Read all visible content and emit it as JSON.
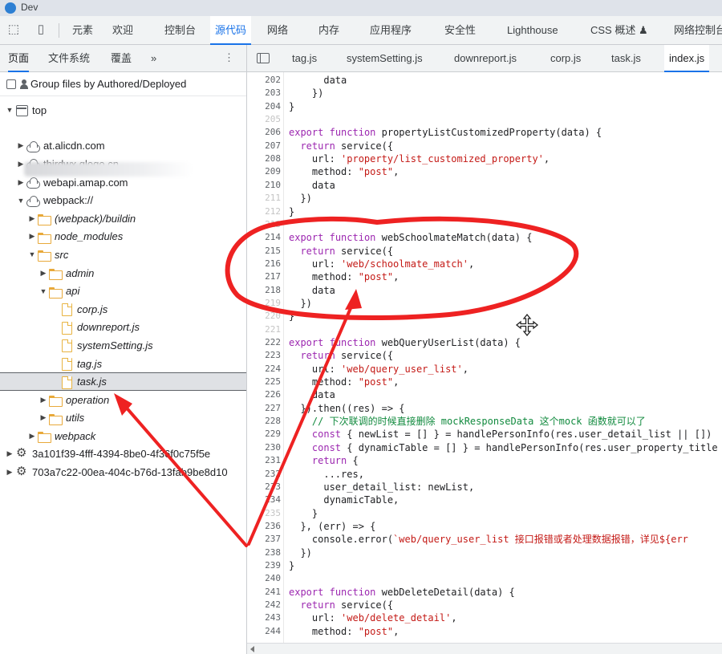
{
  "window": {
    "title": "Dev"
  },
  "toolbar": {
    "tabs": [
      "元素",
      "欢迎",
      "控制台",
      "源代码",
      "网络",
      "内存",
      "应用程序",
      "安全性",
      "Lighthouse",
      "CSS 概述 ♟",
      "网络控制台"
    ],
    "active_index": 3
  },
  "sidebar": {
    "tabs": [
      "页面",
      "文件系统",
      "覆盖",
      "»"
    ],
    "more": "⋮",
    "group_label": "Group files by Authored/Deployed",
    "tree": [
      {
        "label": "top",
        "depth": 0,
        "arrow": "▼",
        "icon": "frame-icon"
      },
      {
        "label": "at.alicdn.com",
        "depth": 1,
        "arrow": "▶",
        "icon": "cloud-icon"
      },
      {
        "label": "thirdwx.qlogo.cn",
        "depth": 1,
        "arrow": "▶",
        "icon": "cloud-icon"
      },
      {
        "label": "webapi.amap.com",
        "depth": 1,
        "arrow": "▶",
        "icon": "cloud-icon"
      },
      {
        "label": "webpack://",
        "depth": 1,
        "arrow": "▼",
        "icon": "cloud-icon"
      },
      {
        "label": "(webpack)/buildin",
        "depth": 2,
        "arrow": "▶",
        "icon": "folder-icon",
        "italic": true
      },
      {
        "label": "node_modules",
        "depth": 2,
        "arrow": "▶",
        "icon": "folder-icon",
        "italic": true
      },
      {
        "label": "src",
        "depth": 2,
        "arrow": "▼",
        "icon": "folder-icon",
        "italic": true
      },
      {
        "label": "admin",
        "depth": 3,
        "arrow": "▶",
        "icon": "folder-icon",
        "italic": true
      },
      {
        "label": "api",
        "depth": 3,
        "arrow": "▼",
        "icon": "folder-icon",
        "italic": true
      },
      {
        "label": "corp.js",
        "depth": 4,
        "arrow": "",
        "icon": "file-icon",
        "italic": true
      },
      {
        "label": "downreport.js",
        "depth": 4,
        "arrow": "",
        "icon": "file-icon",
        "italic": true
      },
      {
        "label": "systemSetting.js",
        "depth": 4,
        "arrow": "",
        "icon": "file-icon",
        "italic": true
      },
      {
        "label": "tag.js",
        "depth": 4,
        "arrow": "",
        "icon": "file-icon",
        "italic": true
      },
      {
        "label": "task.js",
        "depth": 4,
        "arrow": "",
        "icon": "file-icon",
        "italic": true,
        "selected": true
      },
      {
        "label": "operation",
        "depth": 3,
        "arrow": "▶",
        "icon": "folder-icon",
        "italic": true
      },
      {
        "label": "utils",
        "depth": 3,
        "arrow": "▶",
        "icon": "folder-icon",
        "italic": true
      },
      {
        "label": "webpack",
        "depth": 2,
        "arrow": "▶",
        "icon": "folder-icon",
        "italic": true
      },
      {
        "label": "3a101f39-4fff-4394-8be0-4f36f0c75f5e",
        "depth": 0,
        "arrow": "▶",
        "icon": "gear-icon"
      },
      {
        "label": "703a7c22-00ea-404c-b76d-13fab9be8d10",
        "depth": 0,
        "arrow": "▶",
        "icon": "gear-icon"
      }
    ]
  },
  "editor": {
    "tabs": [
      "tag.js",
      "systemSetting.js",
      "downreport.js",
      "corp.js",
      "task.js",
      "index.js"
    ],
    "active_index": 5,
    "lines": [
      {
        "n": "202",
        "t": "      data"
      },
      {
        "n": "203",
        "t": "    })"
      },
      {
        "n": "204",
        "t": "}"
      },
      {
        "n": "205",
        "t": ""
      },
      {
        "n": "206",
        "t": "export function propertyListCustomizedProperty(data) {"
      },
      {
        "n": "207",
        "t": "  return service({"
      },
      {
        "n": "208",
        "t": "    url: 'property/list_customized_property',"
      },
      {
        "n": "209",
        "t": "    method: \"post\","
      },
      {
        "n": "210",
        "t": "    data"
      },
      {
        "n": "211",
        "t": "  })"
      },
      {
        "n": "212",
        "t": "}"
      },
      {
        "n": "213",
        "t": ""
      },
      {
        "n": "214",
        "t": "export function webSchoolmateMatch(data) {"
      },
      {
        "n": "215",
        "t": "  return service({"
      },
      {
        "n": "216",
        "t": "    url: 'web/schoolmate_match',"
      },
      {
        "n": "217",
        "t": "    method: \"post\","
      },
      {
        "n": "218",
        "t": "    data"
      },
      {
        "n": "219",
        "t": "  })"
      },
      {
        "n": "220",
        "t": "}"
      },
      {
        "n": "221",
        "t": ""
      },
      {
        "n": "222",
        "t": "export function webQueryUserList(data) {"
      },
      {
        "n": "223",
        "t": "  return service({"
      },
      {
        "n": "224",
        "t": "    url: 'web/query_user_list',"
      },
      {
        "n": "225",
        "t": "    method: \"post\","
      },
      {
        "n": "226",
        "t": "    data"
      },
      {
        "n": "227",
        "t": "  }).then((res) => {"
      },
      {
        "n": "228",
        "t": "    // 下次联调的时候直接删除 mockResponseData 这个mock 函数就可以了"
      },
      {
        "n": "229",
        "t": "    const { newList = [] } = handlePersonInfo(res.user_detail_list || [])"
      },
      {
        "n": "230",
        "t": "    const { dynamicTable = [] } = handlePersonInfo(res.user_property_title"
      },
      {
        "n": "231",
        "t": "    return {"
      },
      {
        "n": "232",
        "t": "      ...res,"
      },
      {
        "n": "233",
        "t": "      user_detail_list: newList,"
      },
      {
        "n": "234",
        "t": "      dynamicTable,"
      },
      {
        "n": "235",
        "t": "    }"
      },
      {
        "n": "236",
        "t": "  }, (err) => {"
      },
      {
        "n": "237",
        "t": "    console.error(`web/query_user_list 接口报错或者处理数据报错，详见${err"
      },
      {
        "n": "238",
        "t": "  })"
      },
      {
        "n": "239",
        "t": "}"
      },
      {
        "n": "240",
        "t": ""
      },
      {
        "n": "241",
        "t": "export function webDeleteDetail(data) {"
      },
      {
        "n": "242",
        "t": "  return service({"
      },
      {
        "n": "243",
        "t": "    url: 'web/delete_detail',"
      },
      {
        "n": "244",
        "t": "    method: \"post\","
      }
    ]
  },
  "colors": {
    "accent": "#1a73e8",
    "keyword": "#9c27b0",
    "string": "#c41a16",
    "comment": "#118a3e",
    "annotation": "#ee2222"
  }
}
